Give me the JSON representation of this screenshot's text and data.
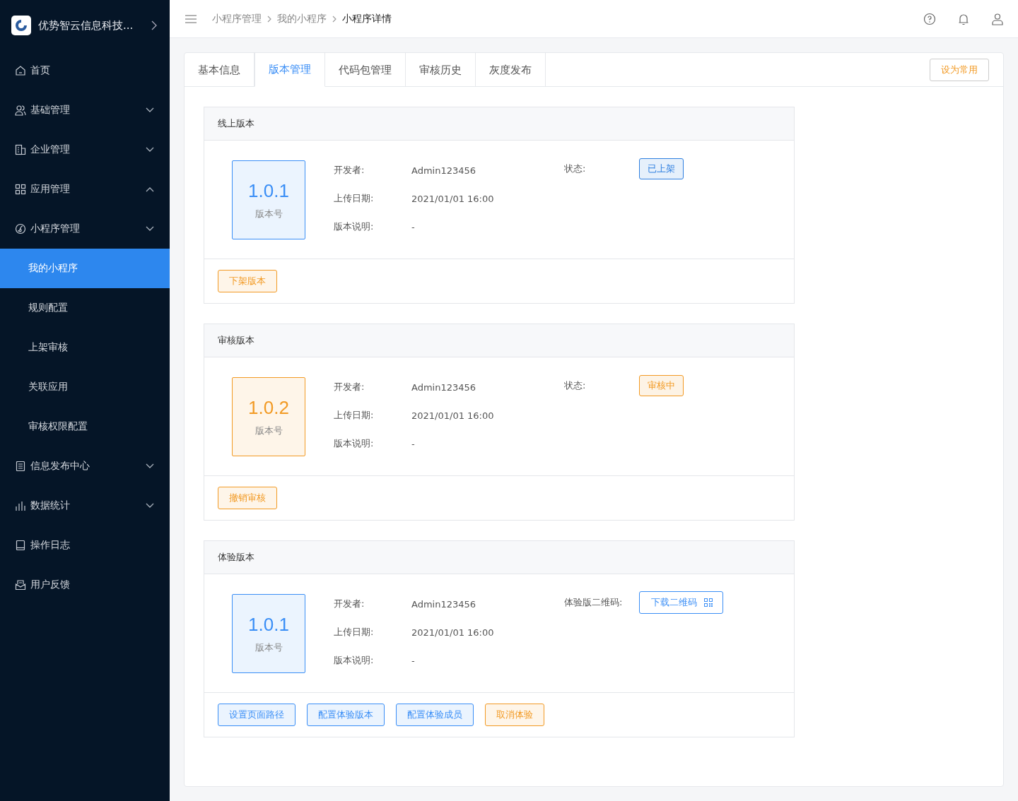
{
  "sidebar": {
    "brand": "优势智云信息科技...",
    "items": [
      {
        "label": "首页",
        "selected": false
      },
      {
        "label": "基础管理",
        "selected": false,
        "expanded": false
      },
      {
        "label": "企业管理",
        "selected": false,
        "expanded": false
      },
      {
        "label": "应用管理",
        "selected": false,
        "expanded": true
      },
      {
        "label": "小程序管理",
        "selected": false,
        "expanded": false,
        "children": [
          {
            "label": "我的小程序",
            "selected": true
          },
          {
            "label": "规则配置",
            "selected": false
          },
          {
            "label": "上架审核",
            "selected": false
          },
          {
            "label": "关联应用",
            "selected": false
          },
          {
            "label": "审核权限配置",
            "selected": false
          }
        ]
      },
      {
        "label": "信息发布中心",
        "selected": false,
        "expanded": false
      },
      {
        "label": "数据统计",
        "selected": false,
        "expanded": false
      },
      {
        "label": "操作日志",
        "selected": false
      },
      {
        "label": "用户反馈",
        "selected": false
      }
    ]
  },
  "breadcrumb": [
    "小程序管理",
    "我的小程序",
    "小程序详情"
  ],
  "tabs": [
    {
      "label": "基本信息",
      "selected": false
    },
    {
      "label": "版本管理",
      "selected": true
    },
    {
      "label": "代码包管理",
      "selected": false
    },
    {
      "label": "审核历史",
      "selected": false
    },
    {
      "label": "灰度发布",
      "selected": false
    }
  ],
  "favorite_button": "设为常用",
  "sections": [
    {
      "title": "线上版本",
      "version": "1.0.1",
      "version_label": "版本号",
      "color": "#3a8ef6",
      "fields": [
        {
          "label": "开发者:",
          "value": "Admin123456"
        },
        {
          "label": "上传日期:",
          "value": "2021/01/01 16:00"
        },
        {
          "label": "版本说明:",
          "value": "-"
        }
      ],
      "side": {
        "kind": "status",
        "label": "状态:",
        "text": "已上架",
        "color": "#2f7fe0"
      },
      "actions": [
        {
          "label": "下架版本",
          "color": "#f29a24"
        }
      ]
    },
    {
      "title": "审核版本",
      "version": "1.0.2",
      "version_label": "版本号",
      "color": "#f29a24",
      "fields": [
        {
          "label": "开发者:",
          "value": "Admin123456"
        },
        {
          "label": "上传日期:",
          "value": "2021/01/01 16:00"
        },
        {
          "label": "版本说明:",
          "value": "-"
        }
      ],
      "side": {
        "kind": "status",
        "label": "状态:",
        "text": "审核中",
        "color": "#f29a24"
      },
      "actions": [
        {
          "label": "撤销审核",
          "color": "#f29a24"
        }
      ]
    },
    {
      "title": "体验版本",
      "version": "1.0.1",
      "version_label": "版本号",
      "color": "#3a8ef6",
      "fields": [
        {
          "label": "开发者:",
          "value": "Admin123456"
        },
        {
          "label": "上传日期:",
          "value": "2021/01/01 16:00"
        },
        {
          "label": "版本说明:",
          "value": "-"
        }
      ],
      "side": {
        "kind": "qr",
        "label": "体验版二维码:",
        "text": "下载二维码"
      },
      "actions": [
        {
          "label": "设置页面路径",
          "color": "#3a8ef6"
        },
        {
          "label": "配置体验版本",
          "color": "#3a8ef6"
        },
        {
          "label": "配置体验成员",
          "color": "#3a8ef6"
        },
        {
          "label": "取消体验",
          "color": "#f29a24"
        }
      ]
    }
  ]
}
